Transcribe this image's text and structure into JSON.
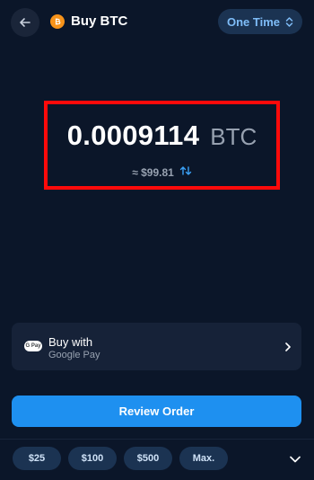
{
  "header": {
    "title": "Buy BTC",
    "mode_label": "One Time"
  },
  "amount": {
    "value": "0.0009114",
    "unit": "BTC",
    "fiat": "≈ $99.81"
  },
  "payment": {
    "title": "Buy with",
    "method": "Google Pay",
    "badge": "G Pay"
  },
  "actions": {
    "review_label": "Review Order"
  },
  "quick_amounts": [
    "$25",
    "$100",
    "$500",
    "Max."
  ],
  "colors": {
    "background": "#0b1629",
    "accent": "#1e90f0",
    "bitcoin": "#f7931a",
    "highlight": "#ff0a0a"
  }
}
